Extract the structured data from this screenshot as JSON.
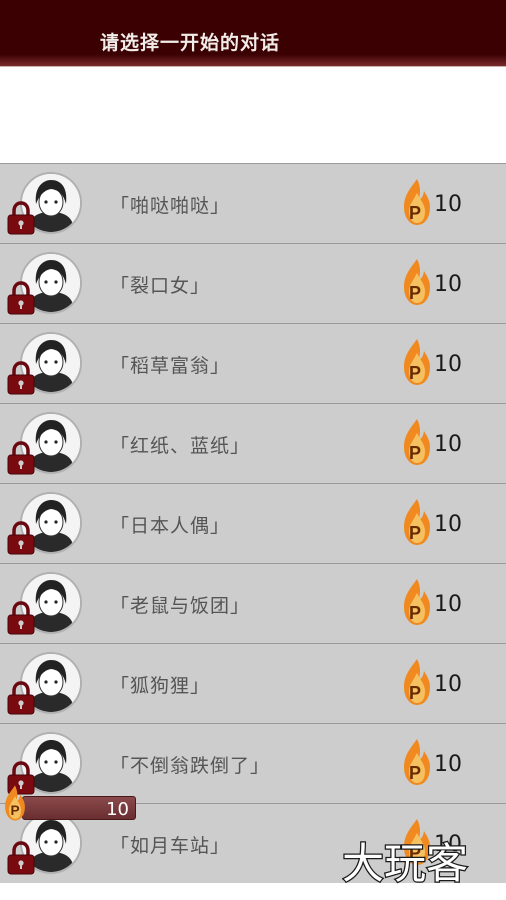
{
  "header": {
    "title": "请选择一开始的对话"
  },
  "conversations": [
    {
      "label": "「啪哒啪哒」",
      "cost": "10"
    },
    {
      "label": "「裂口女」",
      "cost": "10"
    },
    {
      "label": "「稻草富翁」",
      "cost": "10"
    },
    {
      "label": "「红纸、蓝纸」",
      "cost": "10"
    },
    {
      "label": "「日本人偶」",
      "cost": "10"
    },
    {
      "label": "「老鼠与饭团」",
      "cost": "10"
    },
    {
      "label": "「狐狗狸」",
      "cost": "10"
    },
    {
      "label": "「不倒翁跌倒了」",
      "cost": "10"
    },
    {
      "label": "「如月车站」",
      "cost": "10"
    }
  ],
  "balance": {
    "value": "10",
    "currency_icon": "P"
  },
  "watermark": "大玩客",
  "colors": {
    "header": "#3a0002",
    "row": "#cdcdcd",
    "lock": "#7a0a10",
    "flame": "#f08a20"
  }
}
